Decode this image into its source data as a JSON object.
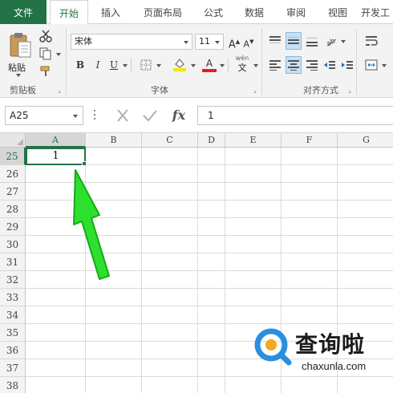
{
  "ribbon_tabs": [
    "文件",
    "开始",
    "插入",
    "页面布局",
    "公式",
    "数据",
    "审阅",
    "视图",
    "开发工"
  ],
  "clipboard": {
    "paste_label": "粘贴",
    "group_label": "剪贴板"
  },
  "font": {
    "name": "宋体",
    "size": "11",
    "group_label": "字体",
    "bold": "B",
    "italic": "I",
    "underline": "U",
    "grow": "A",
    "shrink": "A",
    "color_a": "A",
    "phonetic_top": "wén",
    "phonetic_bottom": "文"
  },
  "alignment": {
    "group_label": "对齐方式"
  },
  "formula_bar": {
    "name_box": "A25",
    "fx": "fx",
    "value": "1"
  },
  "columns": [
    "A",
    "B",
    "C",
    "D",
    "E",
    "F",
    "G"
  ],
  "rows": [
    "25",
    "26",
    "27",
    "28",
    "29",
    "30",
    "31",
    "32",
    "33",
    "34",
    "35",
    "36",
    "37",
    "38"
  ],
  "selected_cell": {
    "column": "A",
    "row": "25",
    "value": "1"
  },
  "watermark": {
    "title": "查询啦",
    "url": "chaxunla.com"
  },
  "colors": {
    "accent": "#217346",
    "arrow": "#2ee02e",
    "highlight_yellow": "#f7e600",
    "font_red": "#e02020",
    "watermark_blue": "#2b8fe0",
    "watermark_orange": "#f5a623"
  }
}
